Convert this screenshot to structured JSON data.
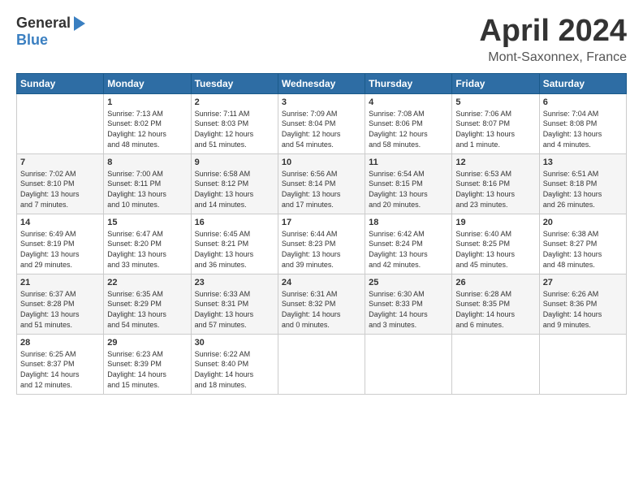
{
  "header": {
    "logo_general": "General",
    "logo_blue": "Blue",
    "title": "April 2024",
    "location": "Mont-Saxonnex, France"
  },
  "columns": [
    "Sunday",
    "Monday",
    "Tuesday",
    "Wednesday",
    "Thursday",
    "Friday",
    "Saturday"
  ],
  "weeks": [
    [
      {
        "day": "",
        "info": ""
      },
      {
        "day": "1",
        "info": "Sunrise: 7:13 AM\nSunset: 8:02 PM\nDaylight: 12 hours\nand 48 minutes."
      },
      {
        "day": "2",
        "info": "Sunrise: 7:11 AM\nSunset: 8:03 PM\nDaylight: 12 hours\nand 51 minutes."
      },
      {
        "day": "3",
        "info": "Sunrise: 7:09 AM\nSunset: 8:04 PM\nDaylight: 12 hours\nand 54 minutes."
      },
      {
        "day": "4",
        "info": "Sunrise: 7:08 AM\nSunset: 8:06 PM\nDaylight: 12 hours\nand 58 minutes."
      },
      {
        "day": "5",
        "info": "Sunrise: 7:06 AM\nSunset: 8:07 PM\nDaylight: 13 hours\nand 1 minute."
      },
      {
        "day": "6",
        "info": "Sunrise: 7:04 AM\nSunset: 8:08 PM\nDaylight: 13 hours\nand 4 minutes."
      }
    ],
    [
      {
        "day": "7",
        "info": "Sunrise: 7:02 AM\nSunset: 8:10 PM\nDaylight: 13 hours\nand 7 minutes."
      },
      {
        "day": "8",
        "info": "Sunrise: 7:00 AM\nSunset: 8:11 PM\nDaylight: 13 hours\nand 10 minutes."
      },
      {
        "day": "9",
        "info": "Sunrise: 6:58 AM\nSunset: 8:12 PM\nDaylight: 13 hours\nand 14 minutes."
      },
      {
        "day": "10",
        "info": "Sunrise: 6:56 AM\nSunset: 8:14 PM\nDaylight: 13 hours\nand 17 minutes."
      },
      {
        "day": "11",
        "info": "Sunrise: 6:54 AM\nSunset: 8:15 PM\nDaylight: 13 hours\nand 20 minutes."
      },
      {
        "day": "12",
        "info": "Sunrise: 6:53 AM\nSunset: 8:16 PM\nDaylight: 13 hours\nand 23 minutes."
      },
      {
        "day": "13",
        "info": "Sunrise: 6:51 AM\nSunset: 8:18 PM\nDaylight: 13 hours\nand 26 minutes."
      }
    ],
    [
      {
        "day": "14",
        "info": "Sunrise: 6:49 AM\nSunset: 8:19 PM\nDaylight: 13 hours\nand 29 minutes."
      },
      {
        "day": "15",
        "info": "Sunrise: 6:47 AM\nSunset: 8:20 PM\nDaylight: 13 hours\nand 33 minutes."
      },
      {
        "day": "16",
        "info": "Sunrise: 6:45 AM\nSunset: 8:21 PM\nDaylight: 13 hours\nand 36 minutes."
      },
      {
        "day": "17",
        "info": "Sunrise: 6:44 AM\nSunset: 8:23 PM\nDaylight: 13 hours\nand 39 minutes."
      },
      {
        "day": "18",
        "info": "Sunrise: 6:42 AM\nSunset: 8:24 PM\nDaylight: 13 hours\nand 42 minutes."
      },
      {
        "day": "19",
        "info": "Sunrise: 6:40 AM\nSunset: 8:25 PM\nDaylight: 13 hours\nand 45 minutes."
      },
      {
        "day": "20",
        "info": "Sunrise: 6:38 AM\nSunset: 8:27 PM\nDaylight: 13 hours\nand 48 minutes."
      }
    ],
    [
      {
        "day": "21",
        "info": "Sunrise: 6:37 AM\nSunset: 8:28 PM\nDaylight: 13 hours\nand 51 minutes."
      },
      {
        "day": "22",
        "info": "Sunrise: 6:35 AM\nSunset: 8:29 PM\nDaylight: 13 hours\nand 54 minutes."
      },
      {
        "day": "23",
        "info": "Sunrise: 6:33 AM\nSunset: 8:31 PM\nDaylight: 13 hours\nand 57 minutes."
      },
      {
        "day": "24",
        "info": "Sunrise: 6:31 AM\nSunset: 8:32 PM\nDaylight: 14 hours\nand 0 minutes."
      },
      {
        "day": "25",
        "info": "Sunrise: 6:30 AM\nSunset: 8:33 PM\nDaylight: 14 hours\nand 3 minutes."
      },
      {
        "day": "26",
        "info": "Sunrise: 6:28 AM\nSunset: 8:35 PM\nDaylight: 14 hours\nand 6 minutes."
      },
      {
        "day": "27",
        "info": "Sunrise: 6:26 AM\nSunset: 8:36 PM\nDaylight: 14 hours\nand 9 minutes."
      }
    ],
    [
      {
        "day": "28",
        "info": "Sunrise: 6:25 AM\nSunset: 8:37 PM\nDaylight: 14 hours\nand 12 minutes."
      },
      {
        "day": "29",
        "info": "Sunrise: 6:23 AM\nSunset: 8:39 PM\nDaylight: 14 hours\nand 15 minutes."
      },
      {
        "day": "30",
        "info": "Sunrise: 6:22 AM\nSunset: 8:40 PM\nDaylight: 14 hours\nand 18 minutes."
      },
      {
        "day": "",
        "info": ""
      },
      {
        "day": "",
        "info": ""
      },
      {
        "day": "",
        "info": ""
      },
      {
        "day": "",
        "info": ""
      }
    ]
  ]
}
